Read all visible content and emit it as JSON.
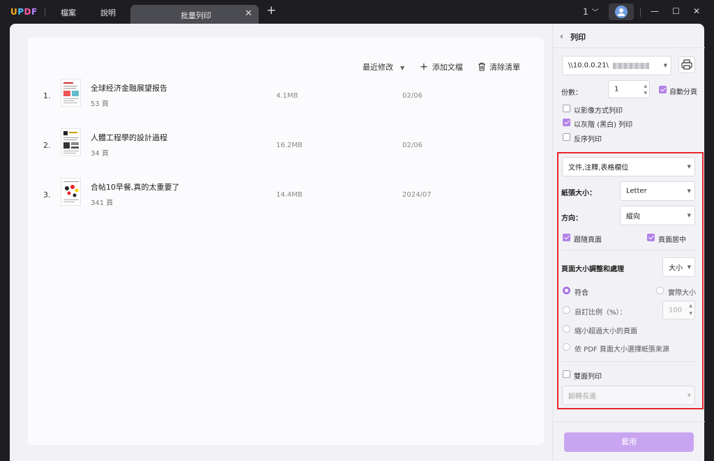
{
  "titlebar": {
    "logo": {
      "u": "U",
      "p": "P",
      "d": "D",
      "f": "F"
    },
    "menu": [
      "檔案",
      "說明"
    ],
    "tab_title": "批量列印",
    "tab_close": "✕",
    "tab_add": "+",
    "count_label": "1",
    "window_controls": {
      "minimize": "—",
      "maximize": "☐",
      "close": "✕"
    }
  },
  "toolbar": {
    "sort_label": "最近修改",
    "add_label": "添加文檔",
    "clear_label": "清除清單"
  },
  "documents": [
    {
      "num": "1.",
      "title": "全球经济金融展望报告",
      "pages": "53 頁",
      "size": "4.1MB",
      "date": "02/06"
    },
    {
      "num": "2.",
      "title": "人體工程學的設計過程",
      "pages": "34 頁",
      "size": "16.2MB",
      "date": "02/06"
    },
    {
      "num": "3.",
      "title": "合帖10早餐,真的太重要了",
      "pages": "341 頁",
      "size": "14.4MB",
      "date": "2024/07"
    }
  ],
  "print_panel": {
    "title": "列印",
    "printer": "\\\\10.0.0.21\\",
    "copies_label": "份數：",
    "copies_value": "1",
    "auto_collate": "自動分頁",
    "as_image": "以影像方式列印",
    "grayscale": "以灰階 (黑白) 列印",
    "reverse": "反序列印",
    "content_select": "文件,注釋,表格欄位",
    "paper_size_label": "紙張大小：",
    "paper_size_value": "Letter",
    "orientation_label": "方向：",
    "orientation_value": "縱向",
    "auto_rotate": "跟隨頁面",
    "center_page": "頁面居中",
    "page_sizing_label": "頁面大小調整和處理",
    "page_sizing_value": "大小",
    "fit": "符合",
    "actual_size": "實際大小",
    "custom_scale": "自訂比例（%）：",
    "custom_scale_value": "100",
    "shrink_oversized": "縮小超過大小的頁面",
    "choose_paper_by_pdf": "依 PDF 頁面大小選擇紙張來源",
    "duplex": "雙面列印",
    "flip_select": "翻轉長邊",
    "apply": "套用"
  }
}
